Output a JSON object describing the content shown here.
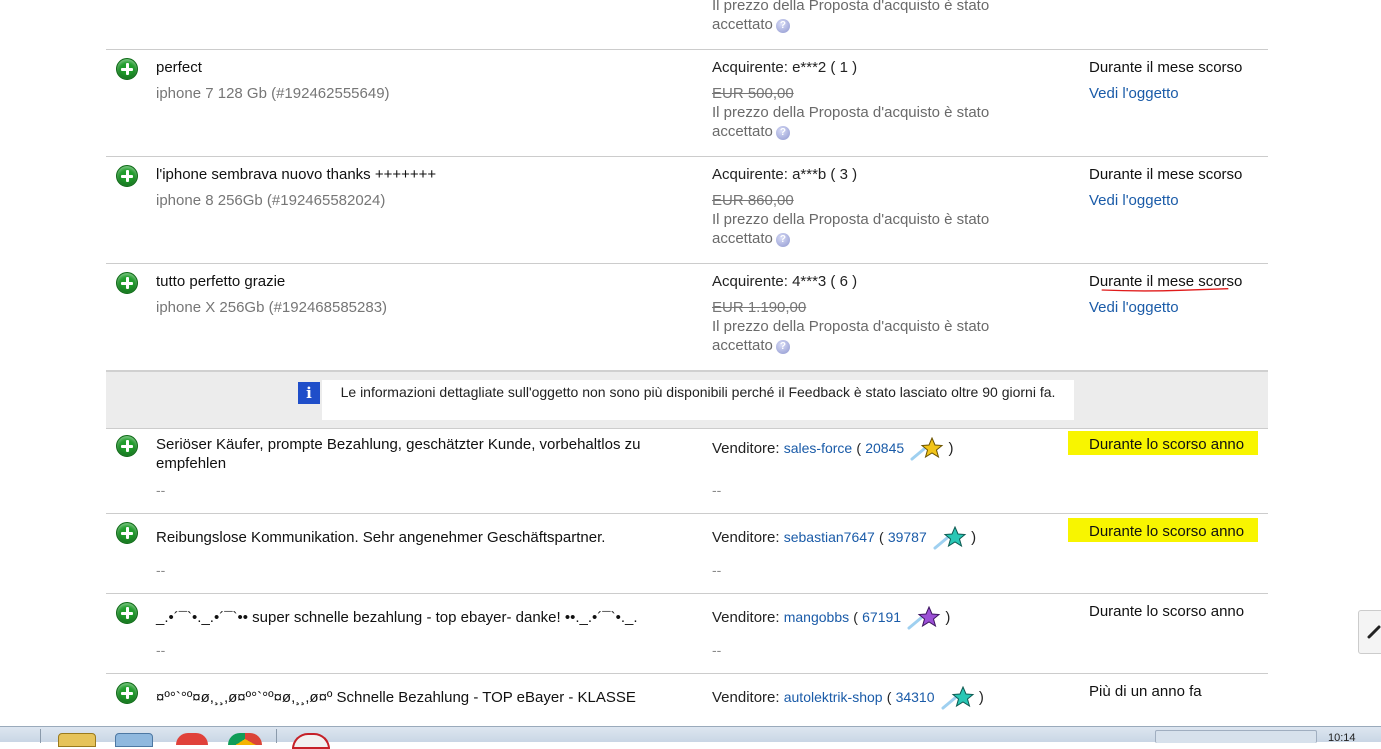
{
  "top_partial": {
    "note_line1": "Il prezzo della Proposta d'acquisto è stato",
    "note_line2": "accettato"
  },
  "rows": [
    {
      "comment": "perfect",
      "item": "iphone 7 128 Gb (#192462555649)",
      "role_label": "Acquirente:",
      "user": "e***2 ( 1 )",
      "price": "EUR 500,00",
      "note_line1": "Il prezzo della Proposta d'acquisto è stato",
      "note_line2": "accettato",
      "time": "Durante il mese scorso",
      "view": "Vedi l'oggetto"
    },
    {
      "comment": "l'iphone sembrava nuovo thanks +++++++",
      "item": "iphone 8 256Gb (#192465582024)",
      "role_label": "Acquirente:",
      "user": "a***b ( 3 )",
      "price": "EUR 860,00",
      "note_line1": "Il prezzo della Proposta d'acquisto è stato",
      "note_line2": "accettato",
      "time": "Durante il mese scorso",
      "view": "Vedi l'oggetto"
    },
    {
      "comment": "tutto perfetto grazie",
      "item": "iphone X 256Gb (#192468585283)",
      "role_label": "Acquirente:",
      "user": "4***3 ( 6 )",
      "price": "EUR 1.190,00",
      "note_line1": "Il prezzo della Proposta d'acquisto è stato",
      "note_line2": "accettato",
      "time": "Durante il mese scorso",
      "view": "Vedi l'oggetto"
    }
  ],
  "info_banner": {
    "icon": "info-icon",
    "text": "Le informazioni dettagliate sull'oggetto non sono più disponibili perché il Feedback è stato lasciato oltre 90 giorni fa."
  },
  "seller_rows": [
    {
      "comment": "Seriöser Käufer, prompte Bezahlung, geschätzter Kunde, vorbehaltlos zu empfehlen",
      "dash": "--",
      "role_label": "Venditore:",
      "user": "sales-force",
      "score": "20845",
      "star_color": "#f2c418",
      "time": "Durante lo scorso anno"
    },
    {
      "comment": "Reibungslose Kommunikation. Sehr angenehmer Geschäftspartner.",
      "dash": "--",
      "role_label": "Venditore:",
      "user": "sebastian7647",
      "score": "39787",
      "star_color": "#29c7b5",
      "time": "Durante lo scorso anno"
    },
    {
      "comment": "_.•´¯`•._.•´¯`•• super schnelle bezahlung - top ebayer- danke! ••._.•´¯`•._.",
      "dash": "--",
      "role_label": "Venditore:",
      "user": "mangobbs",
      "score": "67191",
      "star_color": "#9b4fd6",
      "time": "Durante lo scorso anno"
    },
    {
      "comment": "¤º°`°º¤ø,¸¸,ø¤º°`°º¤ø,¸¸,ø¤º Schnelle Bezahlung - TOP eBayer - KLASSE",
      "dash": "",
      "role_label": "Venditore:",
      "user": "autolektrik-shop",
      "score": "34310",
      "star_color": "#29c7b5",
      "time": "Più di un anno fa"
    }
  ],
  "taskbar": {
    "clock": "10:14"
  },
  "colors": {
    "link": "#1a5ba8",
    "highlight": "#f8f500",
    "underline_red": "#e01b1b",
    "plus_green": "#1f9d2b"
  }
}
